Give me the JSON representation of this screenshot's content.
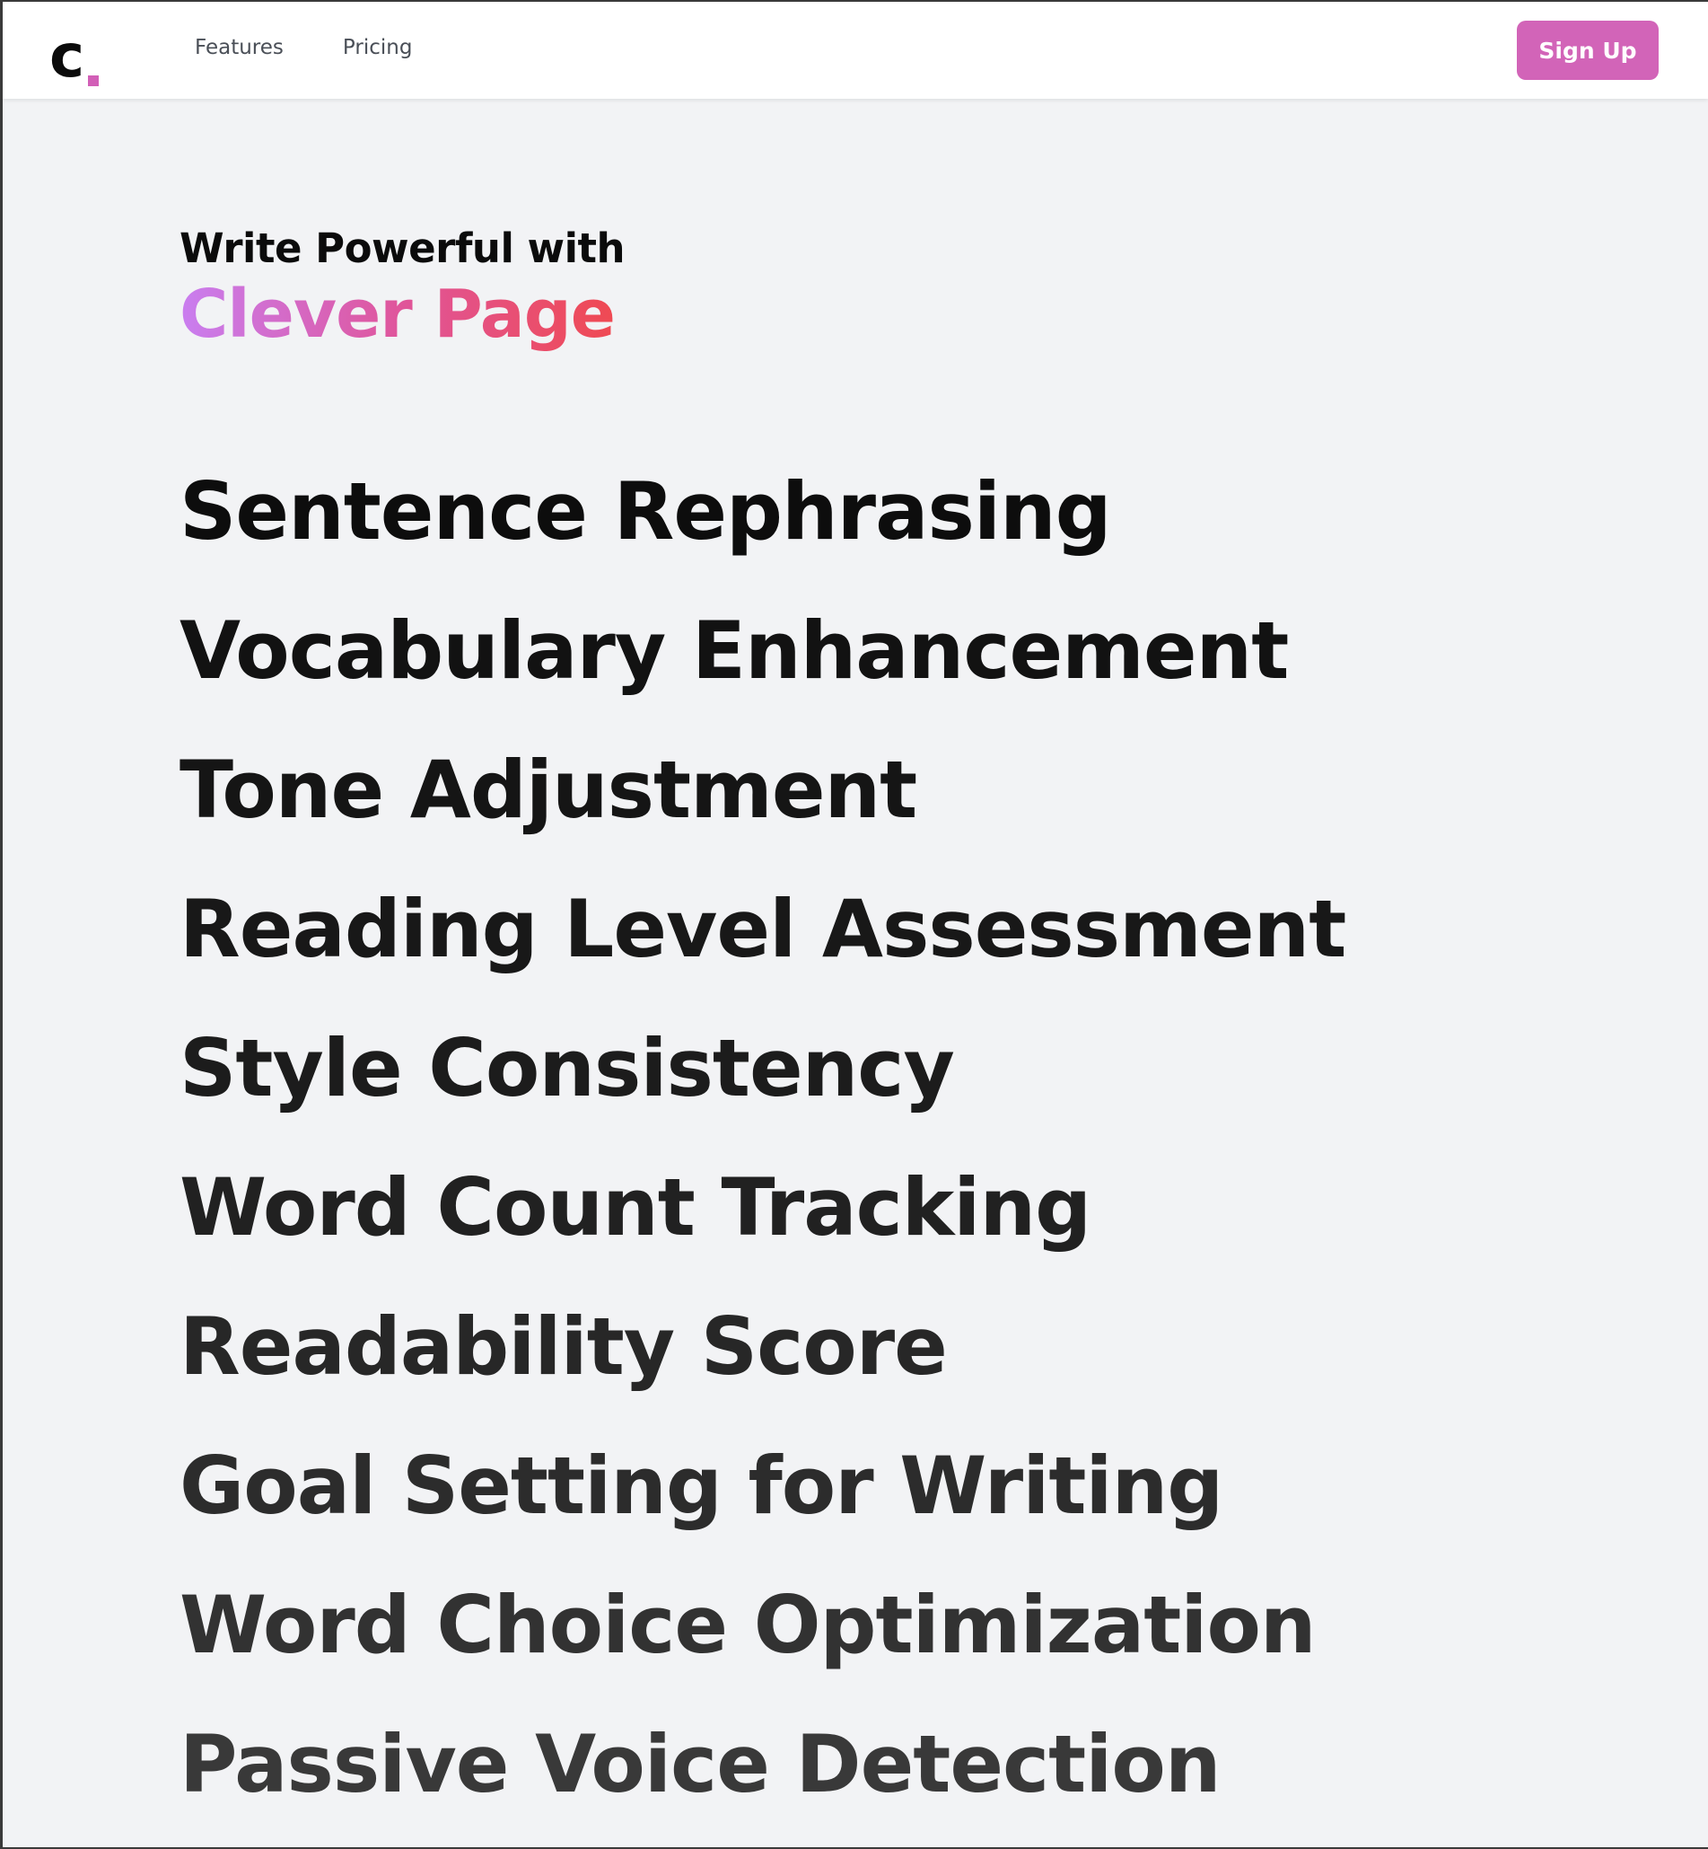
{
  "navbar": {
    "logo_letter": "c",
    "links": [
      "Features",
      "Pricing"
    ],
    "signup_label": "Sign Up"
  },
  "hero": {
    "tagline": "Write Powerful with",
    "brand": "Clever Page"
  },
  "features": [
    "Sentence Rephrasing",
    "Vocabulary Enhancement",
    "Tone Adjustment",
    "Reading Level Assessment",
    "Style Consistency",
    "Word Count Tracking",
    "Readability Score",
    "Goal Setting for Writing",
    "Word Choice Optimization",
    "Passive Voice Detection"
  ],
  "colors": {
    "accent": "#d264b8",
    "brand_gradient": [
      "#c97ef0",
      "#e0559a",
      "#f0494f"
    ],
    "feature_text": [
      "#0d0d0d",
      "#121212",
      "#151515",
      "#181818",
      "#1c1c1c",
      "#212121",
      "#272727",
      "#2c2c2c",
      "#323232",
      "#393939"
    ]
  }
}
